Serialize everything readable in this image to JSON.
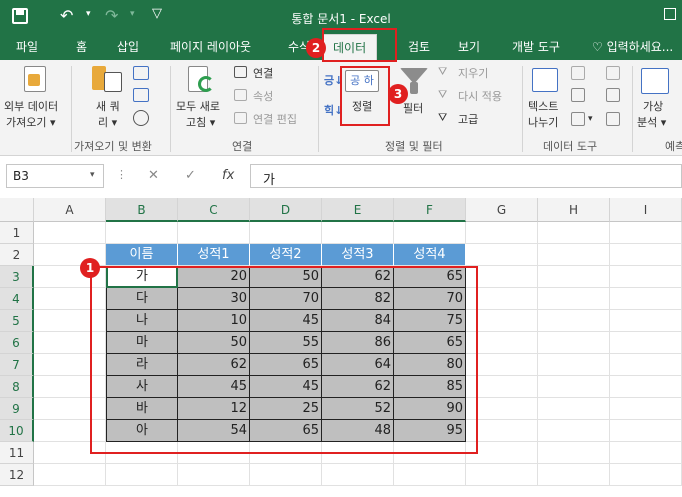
{
  "window": {
    "title": "통합 문서1 - Excel"
  },
  "tabs": [
    {
      "label": "파일"
    },
    {
      "label": "홈"
    },
    {
      "label": "삽입"
    },
    {
      "label": "페이지 레이아웃"
    },
    {
      "label": "수식"
    },
    {
      "label": "데이터"
    },
    {
      "label": "검토"
    },
    {
      "label": "보기"
    },
    {
      "label": "개발 도구"
    }
  ],
  "tell_me": "입력하세요...",
  "ribbon": {
    "get_external": {
      "line1": "외부 데이터",
      "line2": "가져오기 ▾"
    },
    "new_query": {
      "line1": "새 쿼",
      "line2": "리 ▾"
    },
    "group1": "가져오기 및 변환",
    "refresh_all": {
      "line1": "모두 새로",
      "line2": "고침 ▾"
    },
    "connections": "연결",
    "properties": "속성",
    "edit_links": "연결 편집",
    "group2": "연결",
    "sort_az": "공 하",
    "sort": "정렬",
    "filter": "필터",
    "clear": "지우기",
    "reapply": "다시 적용",
    "advanced": "고급",
    "group3": "정렬 및 필터",
    "text_to_col": {
      "line1": "텍스트",
      "line2": "나누기"
    },
    "group4": "데이터 도구",
    "what_if": {
      "line1": "가상",
      "line2": "분석 ▾"
    },
    "group5": "예측"
  },
  "formula_bar": {
    "name_box": "B3",
    "fx": "fx",
    "value": "가"
  },
  "columns": [
    "A",
    "B",
    "C",
    "D",
    "E",
    "F",
    "G",
    "H",
    "I"
  ],
  "rows": [
    "1",
    "2",
    "3",
    "4",
    "5",
    "6",
    "7",
    "8",
    "9",
    "10",
    "11",
    "12"
  ],
  "table": {
    "headers": [
      "이름",
      "성적1",
      "성적2",
      "성적3",
      "성적4"
    ],
    "rows": [
      [
        "가",
        "20",
        "50",
        "62",
        "65"
      ],
      [
        "다",
        "30",
        "70",
        "82",
        "70"
      ],
      [
        "나",
        "10",
        "45",
        "84",
        "75"
      ],
      [
        "마",
        "50",
        "55",
        "86",
        "65"
      ],
      [
        "라",
        "62",
        "65",
        "64",
        "80"
      ],
      [
        "사",
        "45",
        "45",
        "62",
        "85"
      ],
      [
        "바",
        "12",
        "25",
        "52",
        "90"
      ],
      [
        "아",
        "54",
        "65",
        "48",
        "95"
      ]
    ]
  },
  "markers": [
    "1",
    "2",
    "3"
  ],
  "colors": {
    "excel_green": "#217346",
    "header_blue": "#5b9bd5",
    "marker_red": "#e02020",
    "range_gray": "#bfbfbf"
  }
}
